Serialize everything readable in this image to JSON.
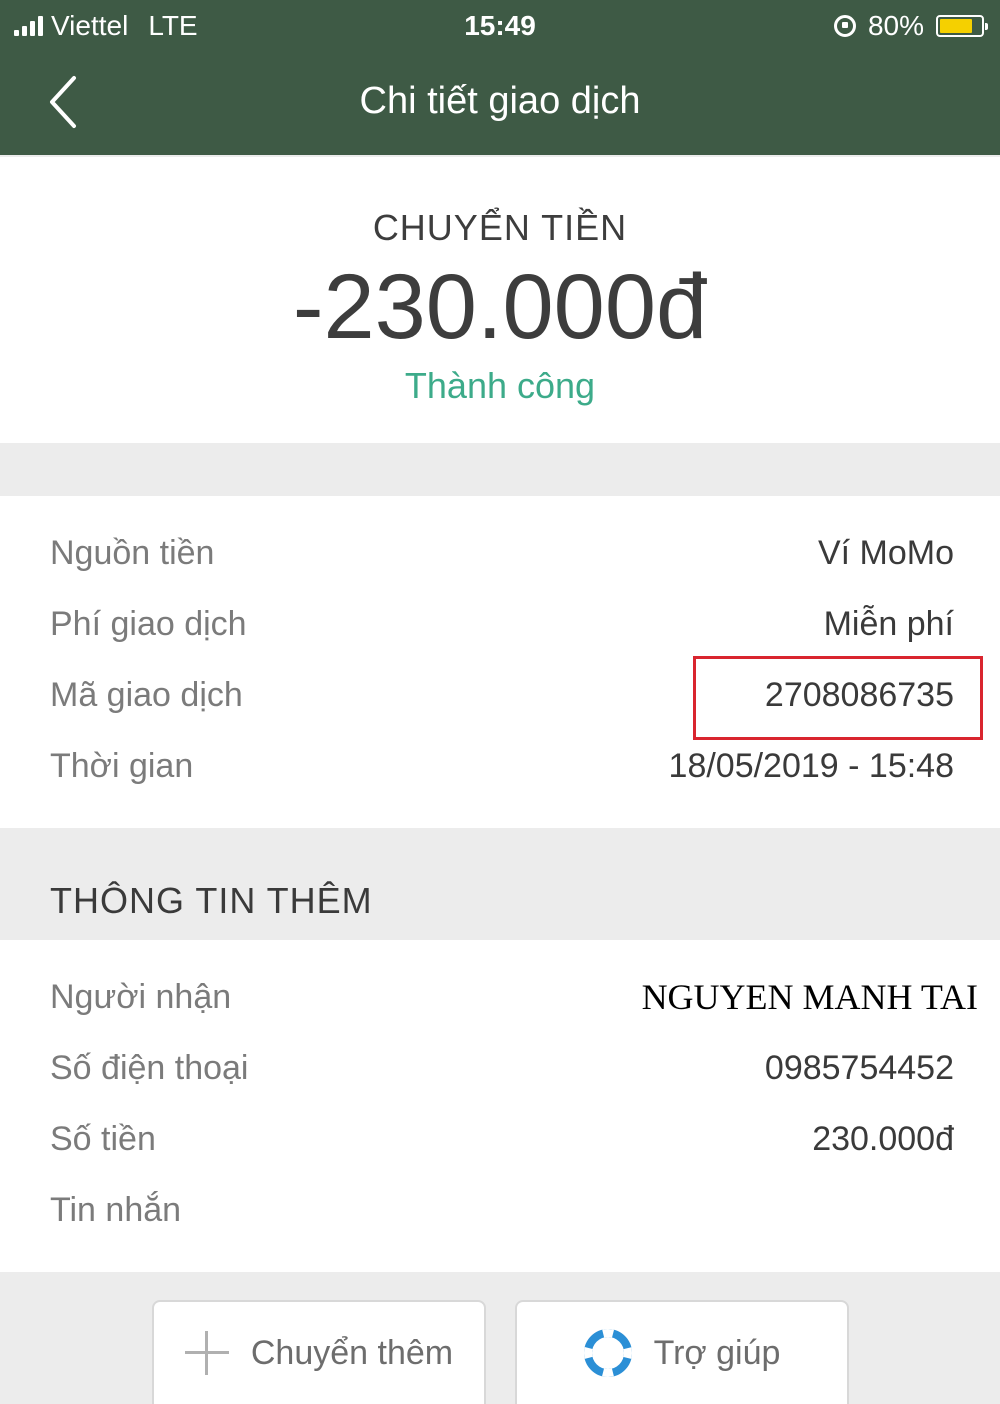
{
  "status_bar": {
    "carrier": "Viettel",
    "network": "LTE",
    "time": "15:49",
    "battery": "80%",
    "battery_level": 0.8,
    "battery_color": "#f5d000"
  },
  "header": {
    "title": "Chi tiết giao dịch",
    "background": "#3e5a45",
    "back_icon": "chevron-left-icon"
  },
  "summary": {
    "type": "CHUYỂN TIỀN",
    "amount": "-230.000đ",
    "status": "Thành công",
    "status_color": "#3dab8a"
  },
  "details": [
    {
      "label": "Nguồn tiền",
      "value": "Ví MoMo"
    },
    {
      "label": "Phí giao dịch",
      "value": "Miễn phí"
    },
    {
      "label": "Mã giao dịch",
      "value": "2708086735"
    },
    {
      "label": "Thời gian",
      "value": "18/05/2019 - 15:48"
    }
  ],
  "highlight_color": "#d9252f",
  "extra_section": {
    "title": "THÔNG TIN THÊM",
    "rows": [
      {
        "label": "Người nhận",
        "value": "NGUYEN MANH TAI"
      },
      {
        "label": "Số điện thoại",
        "value": "0985754452"
      },
      {
        "label": "Số tiền",
        "value": "230.000đ"
      },
      {
        "label": "Tin nhắn",
        "value": ""
      }
    ]
  },
  "actions": {
    "transfer_more": {
      "label": "Chuyển thêm",
      "icon": "plus-icon"
    },
    "help": {
      "label": "Trợ giúp",
      "icon": "lifebuoy-icon"
    }
  }
}
